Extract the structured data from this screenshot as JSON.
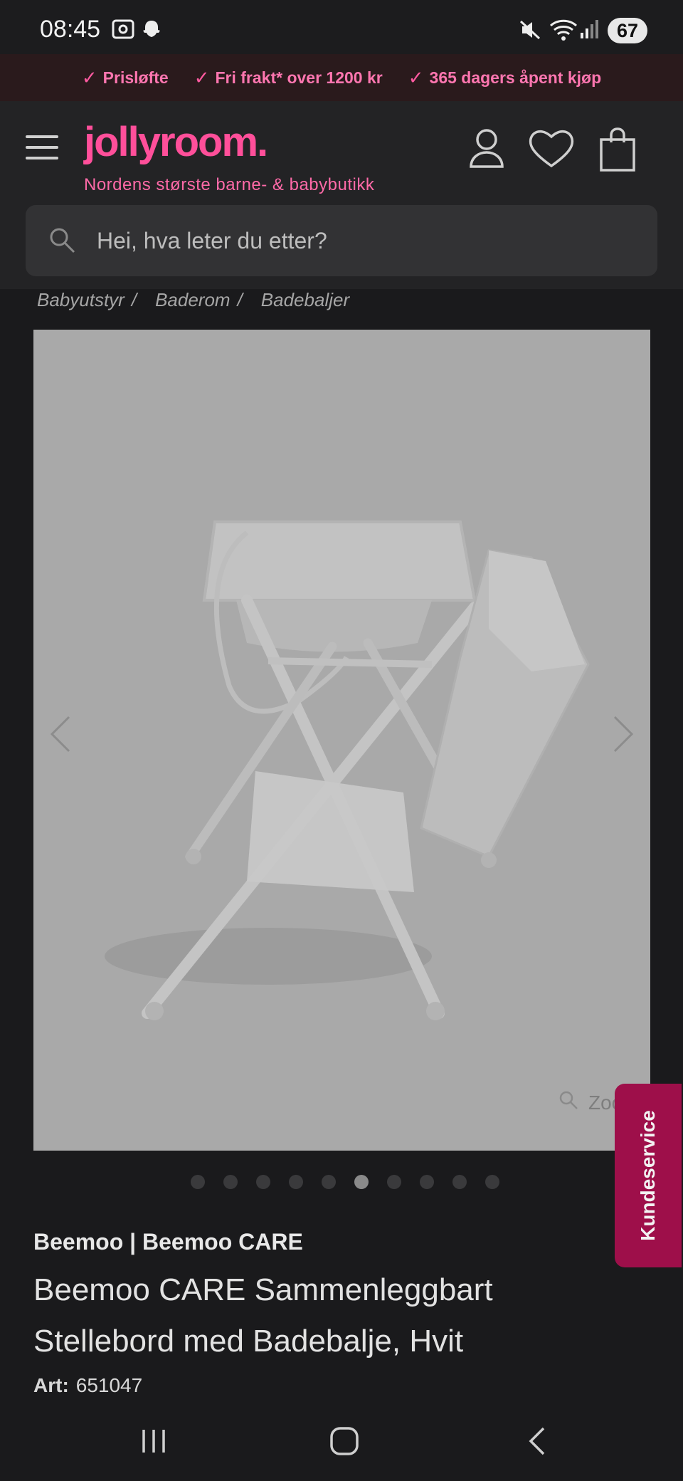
{
  "status_bar": {
    "time": "08:45",
    "battery": "67"
  },
  "promo_bar": {
    "items": [
      "Prisløfte",
      "Fri frakt* over 1200 kr",
      "365 dagers åpent kjøp"
    ]
  },
  "header": {
    "logo": "jollyroom.",
    "tagline": "Nordens største barne- & babybutikk"
  },
  "search": {
    "placeholder": "Hei, hva leter du etter?"
  },
  "breadcrumb": [
    "Babyutstyr",
    "Baderom",
    "Badebaljer"
  ],
  "gallery": {
    "zoom_label": "Zoom",
    "image_count": 10,
    "active_index": 5
  },
  "kundeservice": "Kundeservice",
  "product": {
    "brand": "Beemoo | Beemoo CARE",
    "title": "Beemoo CARE Sammenleggbart Stellebord med Badebalje, Hvit",
    "art_label": "Art:",
    "art_number": "651047"
  },
  "colors": {
    "accent": "#ff4f9a",
    "kundeservice_bg": "#9e0f4a",
    "promo_text": "#ff76b0"
  }
}
